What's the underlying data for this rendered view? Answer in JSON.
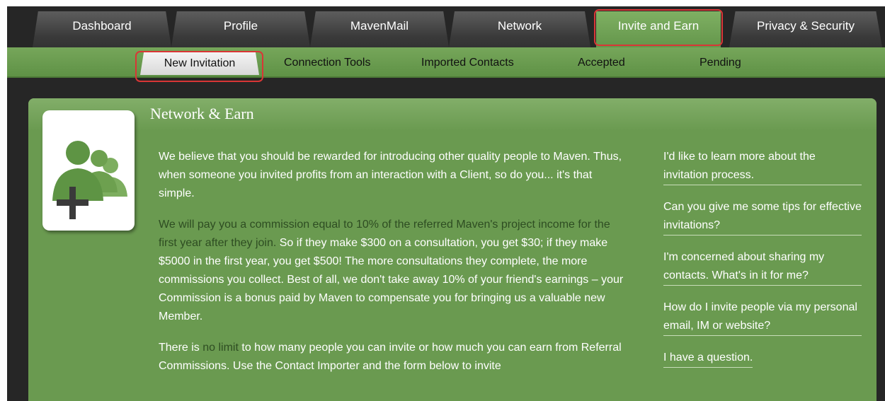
{
  "top_tabs": [
    {
      "label": "Dashboard"
    },
    {
      "label": "Profile"
    },
    {
      "label": "MavenMail"
    },
    {
      "label": "Network"
    },
    {
      "label": "Invite and Earn"
    },
    {
      "label": "Privacy & Security"
    }
  ],
  "sub_nav": [
    {
      "label": "New Invitation"
    },
    {
      "label": "Connection Tools"
    },
    {
      "label": "Imported Contacts"
    },
    {
      "label": "Accepted"
    },
    {
      "label": "Pending"
    }
  ],
  "panel": {
    "title": "Network & Earn",
    "icon": "people-plus-icon",
    "p1": "We believe that you should be rewarded for introducing other quality people to Maven. Thus, when someone you invited profits from an interaction with a Client, so do you... it's that simple.",
    "p2_dim": "We will pay you a commission equal to 10% of the referred Maven's project income for the first year after they join.",
    "p2_rest": " So if they make $300 on a consultation, you get $30; if they make $5000 in the first year, you get $500! The more consultations they complete, the more commissions you collect. Best of all, we don't take away 10% of your friend's earnings – your Commission is a bonus paid by Maven to compensate you for bringing us a valuable new Member.",
    "p3_a": "There is ",
    "p3_dim": "no limit",
    "p3_b": " to how many people you can invite or how much you can earn from Referral Commissions. Use the Contact Importer and the form below to invite"
  },
  "faq": [
    {
      "label": "I'd like to learn more about the invitation process."
    },
    {
      "label": "Can you give me some tips for effective invitations?"
    },
    {
      "label": "I'm concerned about sharing my contacts. What's in it for me?"
    },
    {
      "label": "How do I invite people via my personal email, IM or website?"
    },
    {
      "label": "I have a question."
    }
  ],
  "colors": {
    "nav_green": "#6a9a50",
    "highlight_red": "#d93636"
  }
}
